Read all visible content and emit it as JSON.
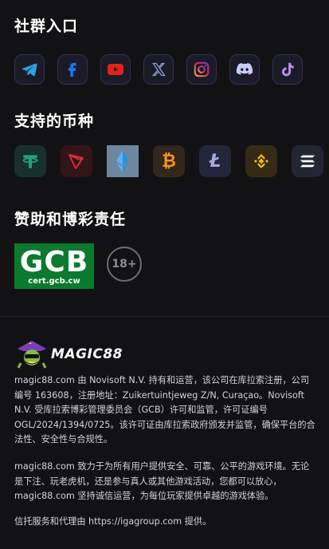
{
  "community": {
    "title": "社群入口",
    "links": [
      {
        "name": "telegram-icon",
        "color": "#2aa3e0"
      },
      {
        "name": "facebook-icon",
        "color": "#1877f2"
      },
      {
        "name": "youtube-icon",
        "color": "#e62117"
      },
      {
        "name": "x-icon",
        "color": "#8e9bd6"
      },
      {
        "name": "instagram-icon",
        "color": "#d6249f"
      },
      {
        "name": "discord-icon",
        "color": "#c7cdf5"
      },
      {
        "name": "tiktok-icon",
        "color": "#b68cf0"
      }
    ]
  },
  "currencies": {
    "title": "支持的币种",
    "coins": [
      {
        "name": "tether-icon",
        "symbol": "T",
        "color": "#26a17b"
      },
      {
        "name": "tron-icon",
        "color": "#e0303a"
      },
      {
        "name": "ethereum-icon",
        "color": "#4aa7e8"
      },
      {
        "name": "bitcoin-icon",
        "symbol": "₿",
        "color": "#f7931a"
      },
      {
        "name": "litecoin-icon",
        "symbol": "Ł",
        "color": "#a6a9e6"
      },
      {
        "name": "binance-icon",
        "color": "#f0b90b"
      },
      {
        "name": "solana-icon",
        "color": "#ffffff"
      }
    ]
  },
  "responsibility": {
    "title": "赞助和博彩责任",
    "gcb_main": "GCB",
    "gcb_sub": "cert.gcb.cw",
    "age_label": "18+"
  },
  "footer": {
    "logo_text": "MAGIC88",
    "para1": "magic88.com 由 Novisoft N.V. 持有和运营，该公司在库拉索注册，公司编号 163608，注册地址：Zuikertuintjeweg Z/N, Curaçao。Novisoft N.V. 受库拉索博彩管理委员会（GCB）许可和监管，许可证编号 OGL/2024/1394/0725。该许可证由库拉索政府颁发并监管，确保平台的合法性、安全性与合规性。",
    "para2": "magic88.com 致力于为所有用户提供安全、可靠、公平的游戏环境。无论是下注、玩老虎机，还是参与真人或其他游戏活动，您都可以放心，magic88.com 坚持诚信运营，为每位玩家提供卓越的游戏体验。",
    "para3": "信托服务和代理由 https://igagroup.com 提供。"
  }
}
